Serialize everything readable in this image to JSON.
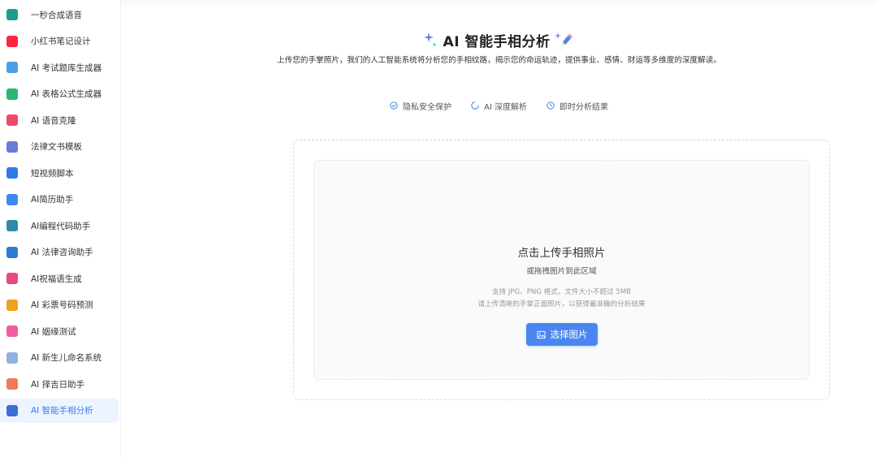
{
  "sidebar": {
    "items": [
      {
        "label": "一秒合成语音",
        "icon": "voice-synth-icon",
        "color": "#1f9c8f",
        "active": false
      },
      {
        "label": "小红书笔记设计",
        "icon": "xiaohongshu-icon",
        "color": "#ff2442",
        "active": false
      },
      {
        "label": "AI 考试题库生成器",
        "icon": "exam-bank-icon",
        "color": "#4a9fe8",
        "active": false
      },
      {
        "label": "AI 表格公式生成器",
        "icon": "spreadsheet-icon",
        "color": "#2bb673",
        "active": false
      },
      {
        "label": "AI 语音克隆",
        "icon": "voice-clone-icon",
        "color": "#f04a6a",
        "active": false
      },
      {
        "label": "法律文书模板",
        "icon": "legal-doc-icon",
        "color": "#6a7bd8",
        "active": false
      },
      {
        "label": "短视频脚本",
        "icon": "video-script-icon",
        "color": "#2f7ae5",
        "active": false
      },
      {
        "label": "AI简历助手",
        "icon": "resume-icon",
        "color": "#3d8bf2",
        "active": false
      },
      {
        "label": "AI编程代码助手",
        "icon": "code-icon",
        "color": "#2c8ca8",
        "active": false
      },
      {
        "label": "AI 法律咨询助手",
        "icon": "scale-icon",
        "color": "#2d7dd2",
        "active": false
      },
      {
        "label": "AI祝福语生成",
        "icon": "blessing-icon",
        "color": "#e84a7a",
        "active": false
      },
      {
        "label": "AI 彩票号码预测",
        "icon": "lottery-icon",
        "color": "#f0a020",
        "active": false
      },
      {
        "label": "AI 姻缘测试",
        "icon": "heart-icon",
        "color": "#f25ca2",
        "active": false
      },
      {
        "label": "AI 新生儿命名系统",
        "icon": "baby-icon",
        "color": "#8fb2e0",
        "active": false
      },
      {
        "label": "AI 择吉日助手",
        "icon": "calendar-icon",
        "color": "#f07a5a",
        "active": false
      },
      {
        "label": "AI 智能手相分析",
        "icon": "palm-icon",
        "color": "#3a6fd8",
        "active": true
      }
    ]
  },
  "header": {
    "title": "AI 智能手相分析",
    "subtitle": "上传您的手掌照片，我们的人工智能系统将分析您的手相纹路，揭示您的命运轨迹，提供事业、感情、财运等多维度的深度解读。"
  },
  "features": [
    {
      "label": "隐私安全保护",
      "icon": "shield-check-icon"
    },
    {
      "label": "AI 深度解析",
      "icon": "spinner-icon"
    },
    {
      "label": "即时分析结果",
      "icon": "clock-icon"
    }
  ],
  "upload": {
    "title": "点击上传手相照片",
    "subtitle": "或拖拽图片到此区域",
    "hint_formats": "支持 JPG、PNG 格式，文件大小不超过 5MB",
    "hint_quality": "请上传清晰的手掌正面照片，以获得最准确的分析结果",
    "button_label": "选择图片"
  },
  "colors": {
    "accent": "#4a86f0",
    "active_text": "#3b7cf0"
  }
}
